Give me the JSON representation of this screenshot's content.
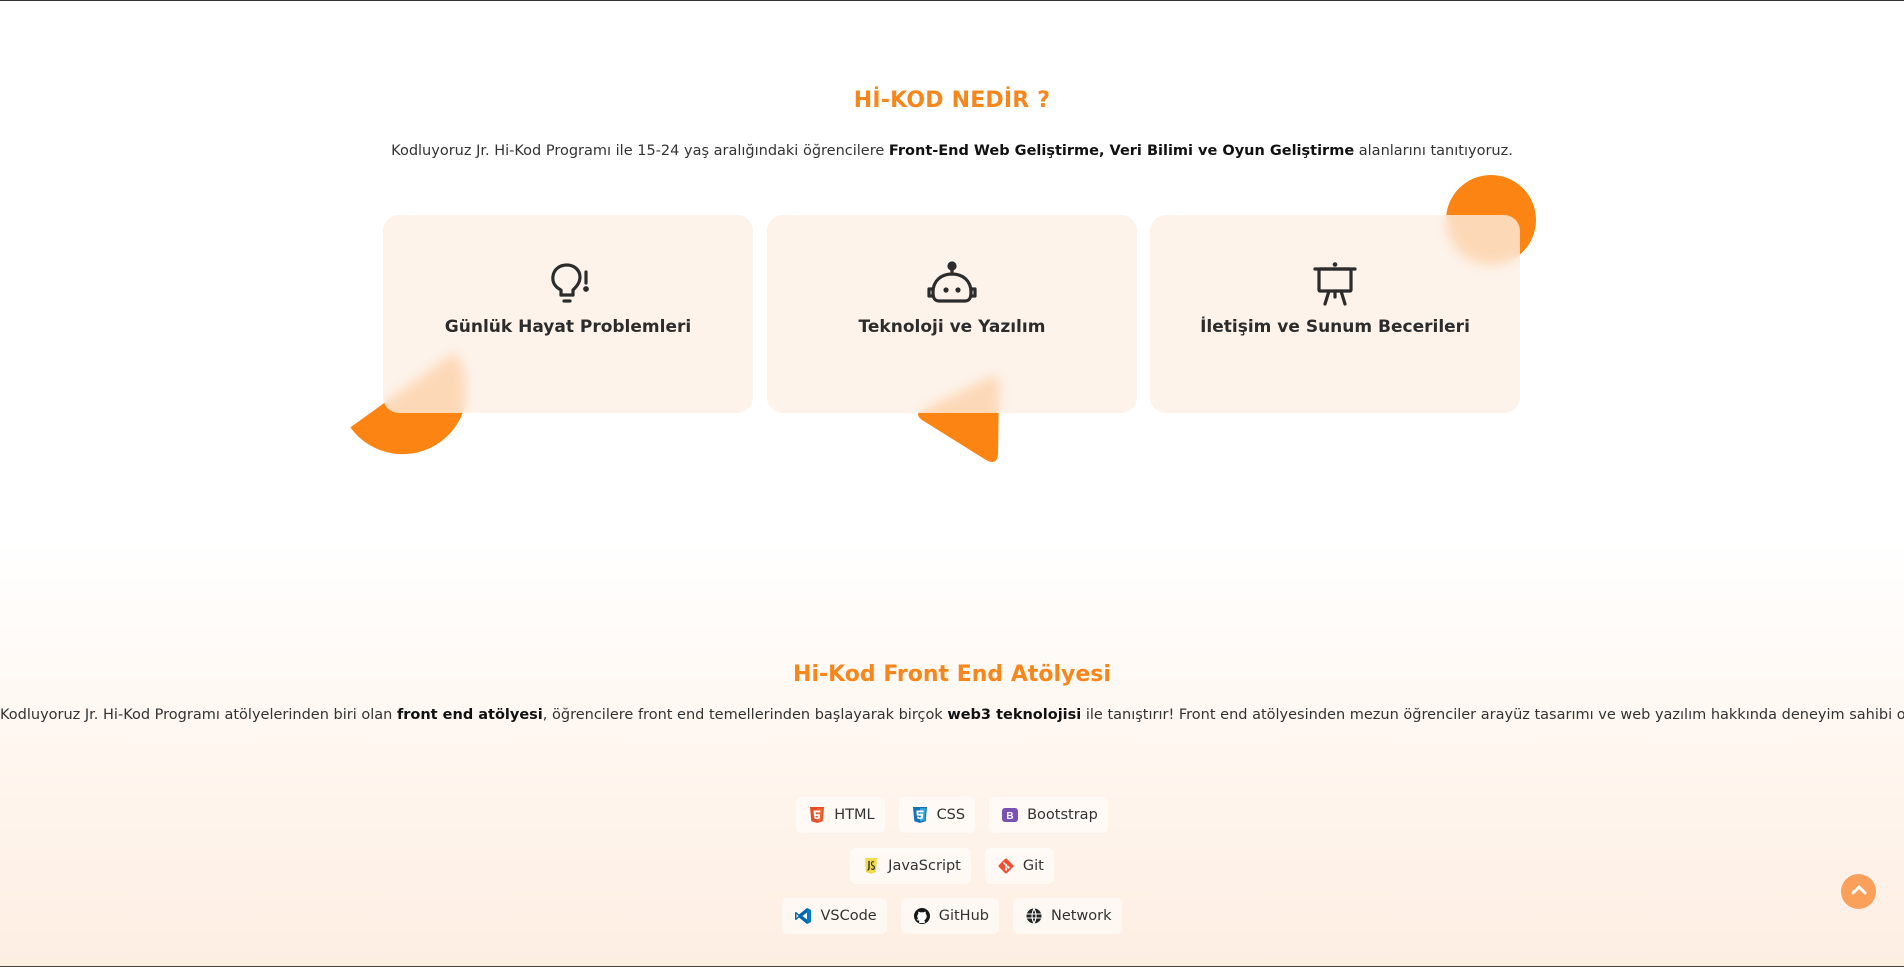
{
  "colors": {
    "accent": "#f7871c",
    "card_bg": "#fdf0e5",
    "shape": "#fb8412"
  },
  "what_is": {
    "title": "Hİ-KOD NEDİR ?",
    "desc_pre": "Kodluyoruz Jr. Hi-Kod Programı ile 15-24 yaş aralığındaki öğrencilere ",
    "desc_bold": "Front-End Web Geliştirme, Veri Bilimi ve Oyun Geliştirme",
    "desc_post": " alanlarını tanıtıyoruz.",
    "cards": [
      {
        "label": "Günlük Hayat Problemleri",
        "icon": "lightbulb-exclamation-icon"
      },
      {
        "label": "Teknoloji ve Yazılım",
        "icon": "robot-icon"
      },
      {
        "label": "İletişim ve Sunum Becerileri",
        "icon": "presentation-board-icon"
      }
    ]
  },
  "workshop": {
    "title": "Hi-Kod Front End Atölyesi",
    "desc_1": "Kodluyoruz Jr. Hi-Kod Programı atölyelerinden biri olan ",
    "desc_bold_1": "front end atölyesi",
    "desc_2": ", öğrencilere front end temellerinden başlayarak birçok ",
    "desc_bold_2": "web3 teknolojisi",
    "desc_3": " ile tanıştırır! Front end atölyesinden mezun öğrenciler arayüz tasarımı ve web yazılım hakkında deneyim sahibi olurlar.",
    "techs": [
      {
        "label": "HTML",
        "icon": "html5-icon",
        "color": "#e44d26"
      },
      {
        "label": "CSS",
        "icon": "css3-icon",
        "color": "#1572b6"
      },
      {
        "label": "Bootstrap",
        "icon": "bootstrap-icon",
        "color": "#7952b3"
      },
      {
        "label": "JavaScript",
        "icon": "javascript-icon",
        "color": "#f0db4f"
      },
      {
        "label": "Git",
        "icon": "git-icon",
        "color": "#f05032"
      },
      {
        "label": "VSCode",
        "icon": "vscode-icon",
        "color": "#007acc"
      },
      {
        "label": "GitHub",
        "icon": "github-icon",
        "color": "#181717"
      },
      {
        "label": "Network",
        "icon": "network-icon",
        "color": "#222222"
      }
    ]
  },
  "scroll_top": {
    "icon": "chevron-up-icon"
  }
}
